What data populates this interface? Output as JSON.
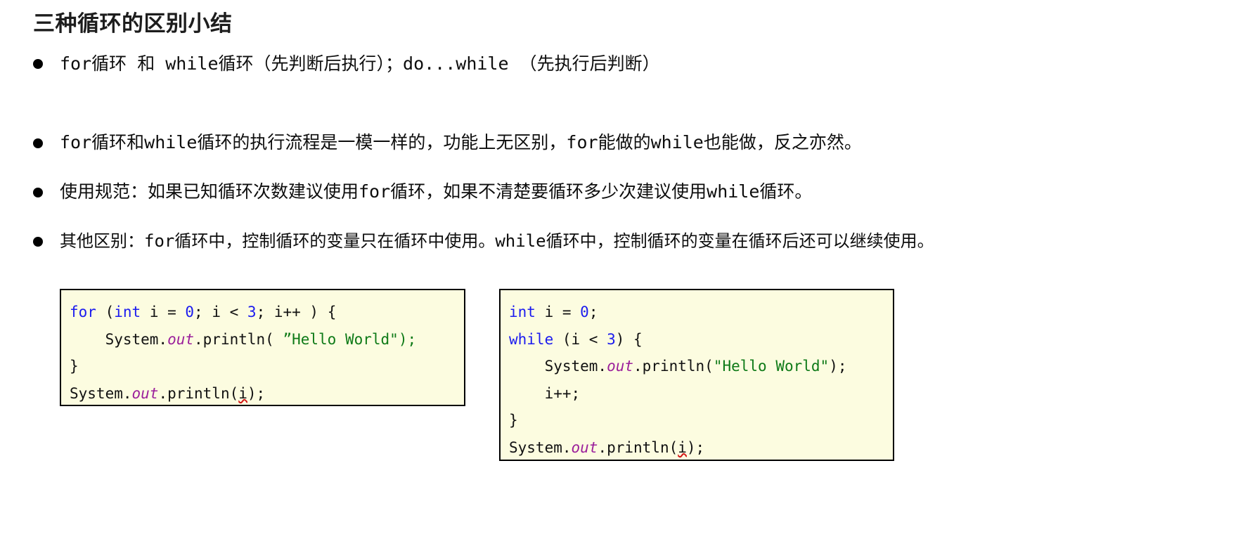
{
  "slide": {
    "title": "三种循环的区别小结",
    "bullet_marker": "filled-circle",
    "bullets": [
      {
        "text": "for循环 和 while循环（先判断后执行）；do...while （先执行后判断）"
      },
      {
        "text": "for循环和while循环的执行流程是一模一样的，功能上无区别，for能做的while也能做，反之亦然。"
      },
      {
        "text": "使用规范：如果已知循环次数建议使用for循环，如果不清楚要循环多少次建议使用while循环。"
      },
      {
        "text": "其他区别：for循环中，控制循环的变量只在循环中使用。while循环中，控制循环的变量在循环后还可以继续使用。"
      }
    ]
  },
  "code_boxes": {
    "for_example": {
      "background": "#fcfce0",
      "border_color": "#000000",
      "lines": [
        [
          {
            "t": "for",
            "c": "kw"
          },
          {
            "t": " (",
            "c": "plain"
          },
          {
            "t": "int",
            "c": "kw"
          },
          {
            "t": " i = ",
            "c": "plain"
          },
          {
            "t": "0",
            "c": "num"
          },
          {
            "t": "; i < ",
            "c": "plain"
          },
          {
            "t": "3",
            "c": "num"
          },
          {
            "t": "; i++ ) {",
            "c": "plain"
          }
        ],
        [
          {
            "t": "    System.",
            "c": "plain"
          },
          {
            "t": "out",
            "c": "field"
          },
          {
            "t": ".println( ",
            "c": "plain"
          },
          {
            "t": "”Hello World\");",
            "c": "str"
          }
        ],
        [
          {
            "t": "}",
            "c": "plain"
          }
        ],
        [
          {
            "t": "System.",
            "c": "plain"
          },
          {
            "t": "out",
            "c": "field"
          },
          {
            "t": ".println(",
            "c": "plain"
          },
          {
            "t": "i",
            "c": "err"
          },
          {
            "t": ");",
            "c": "plain"
          }
        ]
      ]
    },
    "while_example": {
      "background": "#fcfce0",
      "border_color": "#000000",
      "lines": [
        [
          {
            "t": "int",
            "c": "kw"
          },
          {
            "t": " i = ",
            "c": "plain"
          },
          {
            "t": "0",
            "c": "num"
          },
          {
            "t": ";",
            "c": "plain"
          }
        ],
        [
          {
            "t": "while",
            "c": "kw"
          },
          {
            "t": " (i < ",
            "c": "plain"
          },
          {
            "t": "3",
            "c": "num"
          },
          {
            "t": ") {",
            "c": "plain"
          }
        ],
        [
          {
            "t": "    System.",
            "c": "plain"
          },
          {
            "t": "out",
            "c": "field"
          },
          {
            "t": ".println(",
            "c": "plain"
          },
          {
            "t": "\"Hello World\"",
            "c": "str"
          },
          {
            "t": ");",
            "c": "plain"
          }
        ],
        [
          {
            "t": "    i++;",
            "c": "plain"
          }
        ],
        [
          {
            "t": "}",
            "c": "plain"
          }
        ],
        [
          {
            "t": "System.",
            "c": "plain"
          },
          {
            "t": "out",
            "c": "field"
          },
          {
            "t": ".println(",
            "c": "plain"
          },
          {
            "t": "i",
            "c": "err"
          },
          {
            "t": ");",
            "c": "plain"
          }
        ]
      ]
    }
  },
  "colors": {
    "keyword": "#1b1bef",
    "number": "#1b1bef",
    "string": "#0e7a17",
    "field": "#9b1f9b",
    "error_underline": "#d21414",
    "code_bg": "#fcfce0",
    "text": "#0d0d0d",
    "title": "#1d1d1d",
    "page_bg": "#ffffff"
  }
}
